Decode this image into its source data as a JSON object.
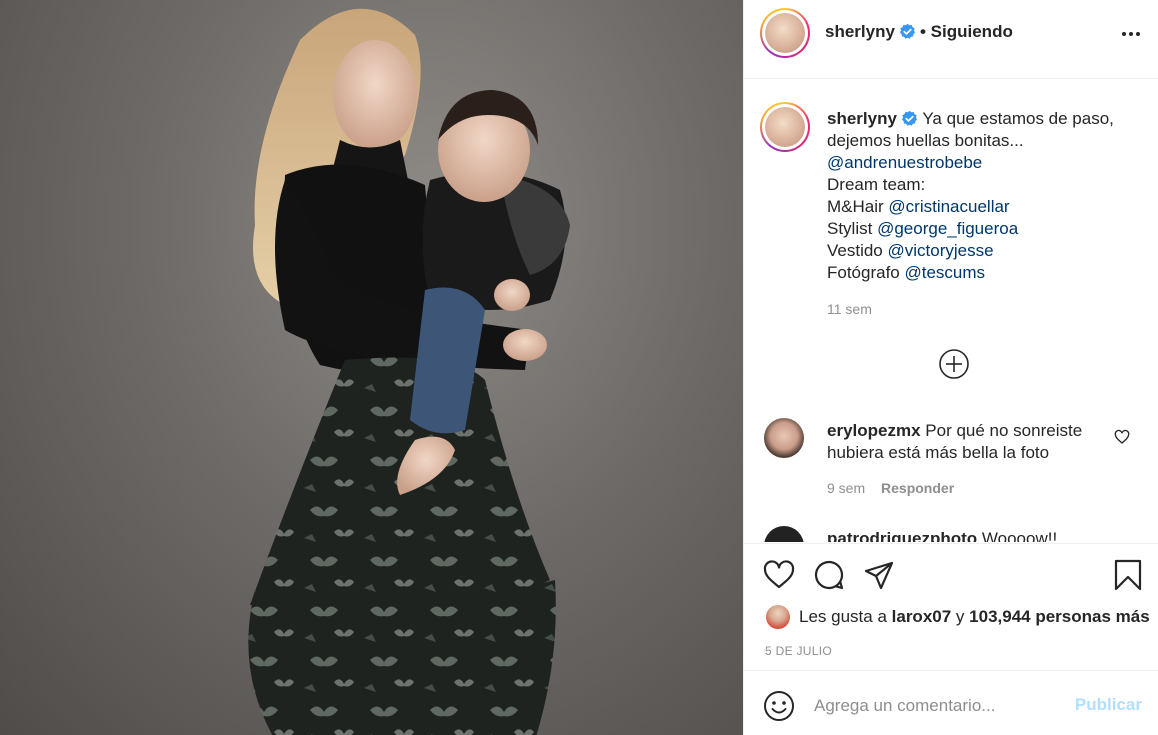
{
  "post": {
    "photo_icon": "photo-mother-and-baby"
  },
  "header": {
    "username": "sherlyny",
    "verified_icon": "verified-badge-icon",
    "follow_status": "• Siguiendo",
    "more_icon": "more-options-icon"
  },
  "caption": {
    "username": "sherlyny",
    "text_line1": "Ya que estamos de paso,",
    "text_line2": "dejemos huellas bonitas...",
    "mention_baby": "@andrenuestrobebe",
    "team_label": "Dream team:",
    "credits": [
      {
        "role": "M&Hair",
        "handle": "@cristinacuellar"
      },
      {
        "role": "Stylist",
        "handle": "@george_figueroa"
      },
      {
        "role": "Vestido",
        "handle": "@victoryjesse"
      },
      {
        "role": "Fotógrafo",
        "handle": "@tescums"
      }
    ],
    "time": "11 sem"
  },
  "comments": [
    {
      "username": "erylopezmx",
      "text": "Por qué no sonreiste hubiera está más bella la foto",
      "time": "9 sem",
      "reply_label": "Responder"
    },
    {
      "username": "patrodriguezphoto",
      "text": "Woooow!!"
    }
  ],
  "actions": {
    "like_icon": "heart-icon",
    "comment_icon": "comment-bubble-icon",
    "share_icon": "paper-plane-icon",
    "save_icon": "bookmark-icon",
    "load_more_icon": "plus-circle-icon"
  },
  "likes": {
    "prefix": "Les gusta a",
    "user": "larox07",
    "connector": "y",
    "count_text": "103,944 personas más"
  },
  "date": "5 DE JULIO",
  "add_comment": {
    "emoji_icon": "smiley-icon",
    "placeholder": "Agrega un comentario...",
    "publish_label": "Publicar"
  },
  "colors": {
    "link": "#00376b",
    "secondary_text": "#8e8e8e",
    "verified": "#3897f0",
    "publish_disabled": "#b2dffc"
  }
}
